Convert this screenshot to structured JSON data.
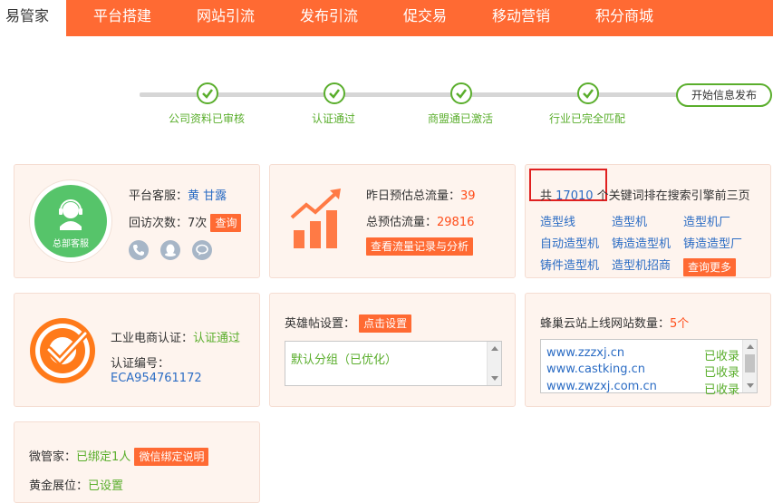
{
  "nav": {
    "tabs": [
      "易管家",
      "平台搭建",
      "网站引流",
      "发布引流",
      "促交易",
      "移动营销",
      "积分商城"
    ]
  },
  "steps": {
    "items": [
      "公司资料已审核",
      "认证通过",
      "商盟通已激活",
      "行业已完全匹配"
    ],
    "final": "开始信息发布"
  },
  "service": {
    "avatar_label": "总部客服",
    "label": "平台客服：",
    "names": "黄 甘露",
    "visits_label": "回访次数：",
    "visits": "7次",
    "query_button": "查询"
  },
  "traffic": {
    "yesterday_label": "昨日预估总流量：",
    "yesterday_value": "39",
    "total_label": "总预估流量：",
    "total_value": "29816",
    "button": "查看流量记录与分析"
  },
  "keywords": {
    "prefix": "共",
    "count": "17010",
    "unit": "个",
    "suffix": "关键词排在搜索引擎前三页",
    "items": [
      "造型线",
      "造型机",
      "造型机厂",
      "自动造型机",
      "铸造造型机",
      "铸造造型厂",
      "铸件造型机",
      "造型机招商"
    ],
    "more_button": "查询更多"
  },
  "cert": {
    "label": "工业电商认证：",
    "status": "认证通过",
    "number_label": "认证编号：",
    "number": "ECA954761172",
    "seal_text": "工业电商认证"
  },
  "hero": {
    "label": "英雄帖设置：",
    "button": "点击设置",
    "content": "默认分组（已优化）"
  },
  "sites": {
    "label": "蜂巢云站上线网站数量：",
    "count": "5个",
    "rows": [
      {
        "url": "www.zzzxj.cn",
        "status": "已收录"
      },
      {
        "url": "www.castking.cn",
        "status": "已收录"
      },
      {
        "url": "www.zwzxj.com.cn",
        "status": "已收录"
      }
    ]
  },
  "wechat": {
    "label": "微管家：",
    "status": "已绑定1人",
    "button": "微信绑定说明",
    "gold_label": "黄金展位：",
    "gold_status": "已设置"
  },
  "colors": {
    "accent": "#ff6a33",
    "success": "#5aae2c",
    "link": "#2b6cc4",
    "highlight_box": "#e02020"
  }
}
